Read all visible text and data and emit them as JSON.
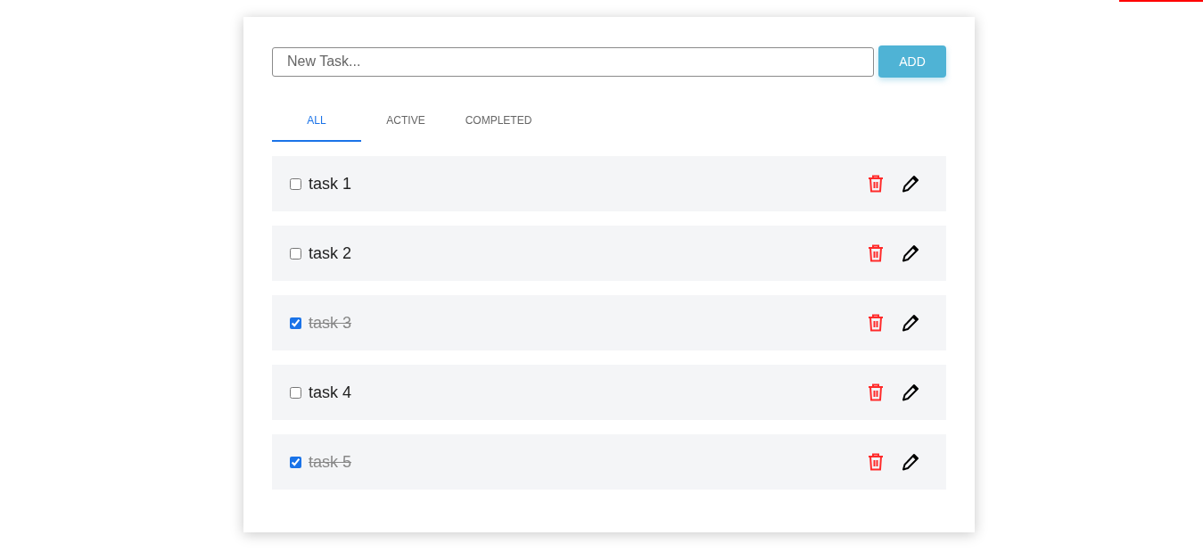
{
  "new_task": {
    "placeholder": "New Task...",
    "button": "ADD"
  },
  "tabs": [
    {
      "label": "ALL",
      "selected": true
    },
    {
      "label": "ACTIVE",
      "selected": false
    },
    {
      "label": "COMPLETED",
      "selected": false
    }
  ],
  "tasks": [
    {
      "text": "task 1",
      "checked": false
    },
    {
      "text": "task 2",
      "checked": false
    },
    {
      "text": "task 3",
      "checked": true
    },
    {
      "text": "task 4",
      "checked": false
    },
    {
      "text": "task 5",
      "checked": true
    }
  ]
}
